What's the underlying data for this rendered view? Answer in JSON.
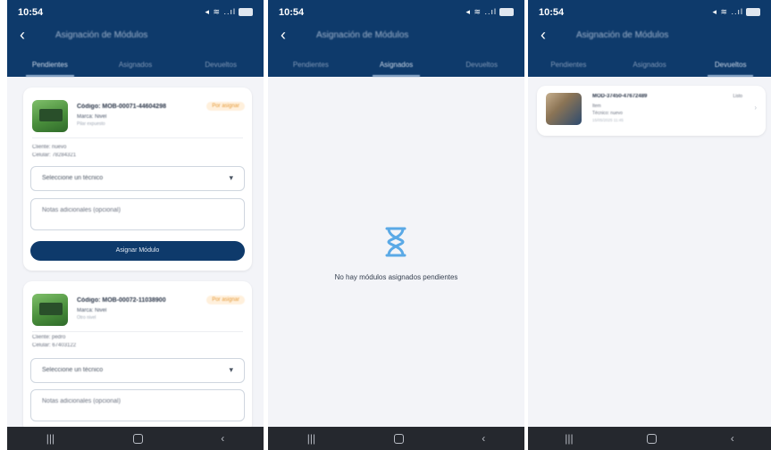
{
  "status": {
    "time": "10:54",
    "signal": "◂ ≋ ..ıl"
  },
  "header": {
    "back_glyph": "‹",
    "title": "Asignación de Módulos",
    "tabs": [
      "Pendientes",
      "Asignados",
      "Devueltos"
    ]
  },
  "pending": {
    "cards": [
      {
        "code": "Código: MOB-00071-44604298",
        "model": "Marca: Nivel",
        "detail": "Pilar expuesto",
        "badge": "Por asignar",
        "client": "Cliente: nuevo",
        "phone": "Celular: 78284321",
        "select_label": "Seleccione un técnico",
        "notes_placeholder": "Notas adicionales (opcional)",
        "assign_label": "Asignar Módulo"
      },
      {
        "code": "Código: MOB-00072-11038900",
        "model": "Marca: Nivel",
        "detail": "Otro nivel",
        "badge": "Por asignar",
        "client": "Cliente: pedro",
        "phone": "Celular: 67403122",
        "select_label": "Seleccione un técnico",
        "notes_placeholder": "Notas adicionales (opcional)"
      }
    ]
  },
  "assigned": {
    "empty_message": "No hay módulos asignados pendientes"
  },
  "returned": {
    "card": {
      "code": "MOD-37450-47672489",
      "tag": "Listo",
      "line1": "Item",
      "line2": "Técnico: nuevo",
      "line3": "15/05/2025 11:45"
    }
  },
  "navbar": {
    "recents": "|||",
    "back": "‹"
  },
  "colors": {
    "primary": "#0e3a6b",
    "badge_bg": "#fff0dc",
    "badge_text": "#e59a3a",
    "empty_icon": "#5aa9e6"
  }
}
